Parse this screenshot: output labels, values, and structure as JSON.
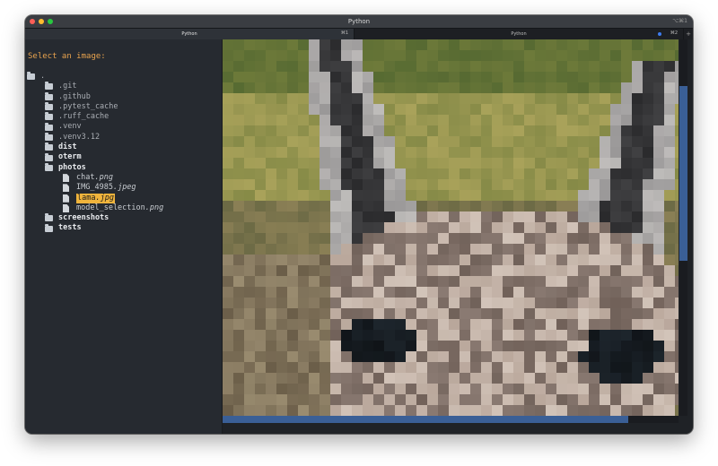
{
  "window": {
    "title": "Python",
    "title_shortcut": "⌥⌘1"
  },
  "tabs": [
    {
      "label": "Python",
      "shortcut": "⌘1",
      "active": true
    },
    {
      "label": "Python",
      "shortcut": "⌘2",
      "active": false
    }
  ],
  "new_tab_label": "+",
  "prompt": "Select an image:",
  "tree": [
    {
      "name": ".",
      "kind": "folder",
      "depth": 0,
      "style": "dim"
    },
    {
      "name": ".git",
      "kind": "folder",
      "depth": 1,
      "style": "dim"
    },
    {
      "name": ".github",
      "kind": "folder",
      "depth": 1,
      "style": "dim"
    },
    {
      "name": ".pytest_cache",
      "kind": "folder",
      "depth": 1,
      "style": "dim"
    },
    {
      "name": ".ruff_cache",
      "kind": "folder",
      "depth": 1,
      "style": "dim"
    },
    {
      "name": ".venv",
      "kind": "folder",
      "depth": 1,
      "style": "dim"
    },
    {
      "name": ".venv3.12",
      "kind": "folder",
      "depth": 1,
      "style": "dim"
    },
    {
      "name": "dist",
      "kind": "folder",
      "depth": 1,
      "style": "bold"
    },
    {
      "name": "oterm",
      "kind": "folder",
      "depth": 1,
      "style": "bold"
    },
    {
      "name": "photos",
      "kind": "folder",
      "depth": 1,
      "style": "bold"
    },
    {
      "name": "chat",
      "ext": ".png",
      "kind": "file",
      "depth": 2,
      "style": "file"
    },
    {
      "name": "IMG_4985",
      "ext": ".jpeg",
      "kind": "file",
      "depth": 2,
      "style": "file"
    },
    {
      "name": "lama",
      "ext": ".jpg",
      "kind": "file",
      "depth": 2,
      "style": "file",
      "selected": true
    },
    {
      "name": "model_selection",
      "ext": ".png",
      "kind": "file",
      "depth": 2,
      "style": "file"
    },
    {
      "name": "screenshots",
      "kind": "folder",
      "depth": 1,
      "style": "bold"
    },
    {
      "name": "tests",
      "kind": "folder",
      "depth": 1,
      "style": "bold"
    }
  ],
  "preview": {
    "subject": "pixelated llama close-up",
    "palette": {
      "background_green": "#6e7a3a",
      "grass_yellow": "#a9a25a",
      "ear_dark": "#2a2a2c",
      "ear_light": "#9a9898",
      "fur_light": "#b9a79b",
      "fur_mid": "#8a7a72",
      "eye": "#101418"
    }
  },
  "colors": {
    "prompt": "#e8a34e",
    "selection": "#f0b43c",
    "scrollbar": "#3a5f96"
  }
}
